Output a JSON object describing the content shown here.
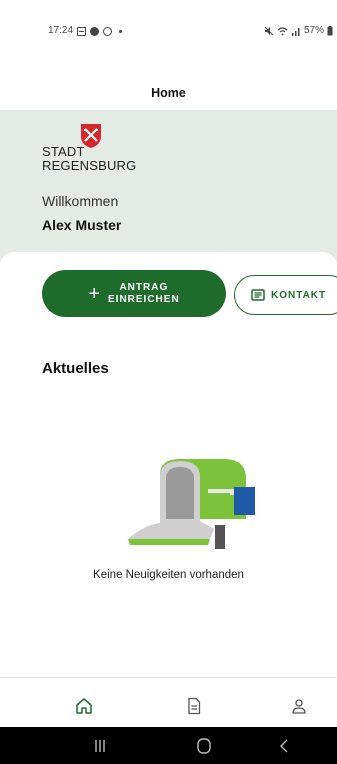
{
  "status_bar": {
    "time": "17:24",
    "battery": "57%"
  },
  "header": {
    "title": "Home"
  },
  "hero": {
    "logo_line1": "STADT",
    "logo_line2": "REGENSBURG",
    "welcome": "Willkommen",
    "user_name": "Alex Muster"
  },
  "actions": {
    "antrag_line1": "ANTRAG",
    "antrag_line2": "EINREICHEN",
    "kontakt_label": "KONTAKT"
  },
  "news": {
    "section_title": "Aktuelles",
    "empty_text": "Keine Neuigkeiten vorhanden"
  },
  "bottom_nav": {
    "items": [
      "home-icon",
      "document-icon",
      "profile-icon"
    ],
    "active_color": "#1f6b2c"
  },
  "colors": {
    "accent": "#1f6b2c",
    "hero_bg": "#e3ebe4"
  }
}
